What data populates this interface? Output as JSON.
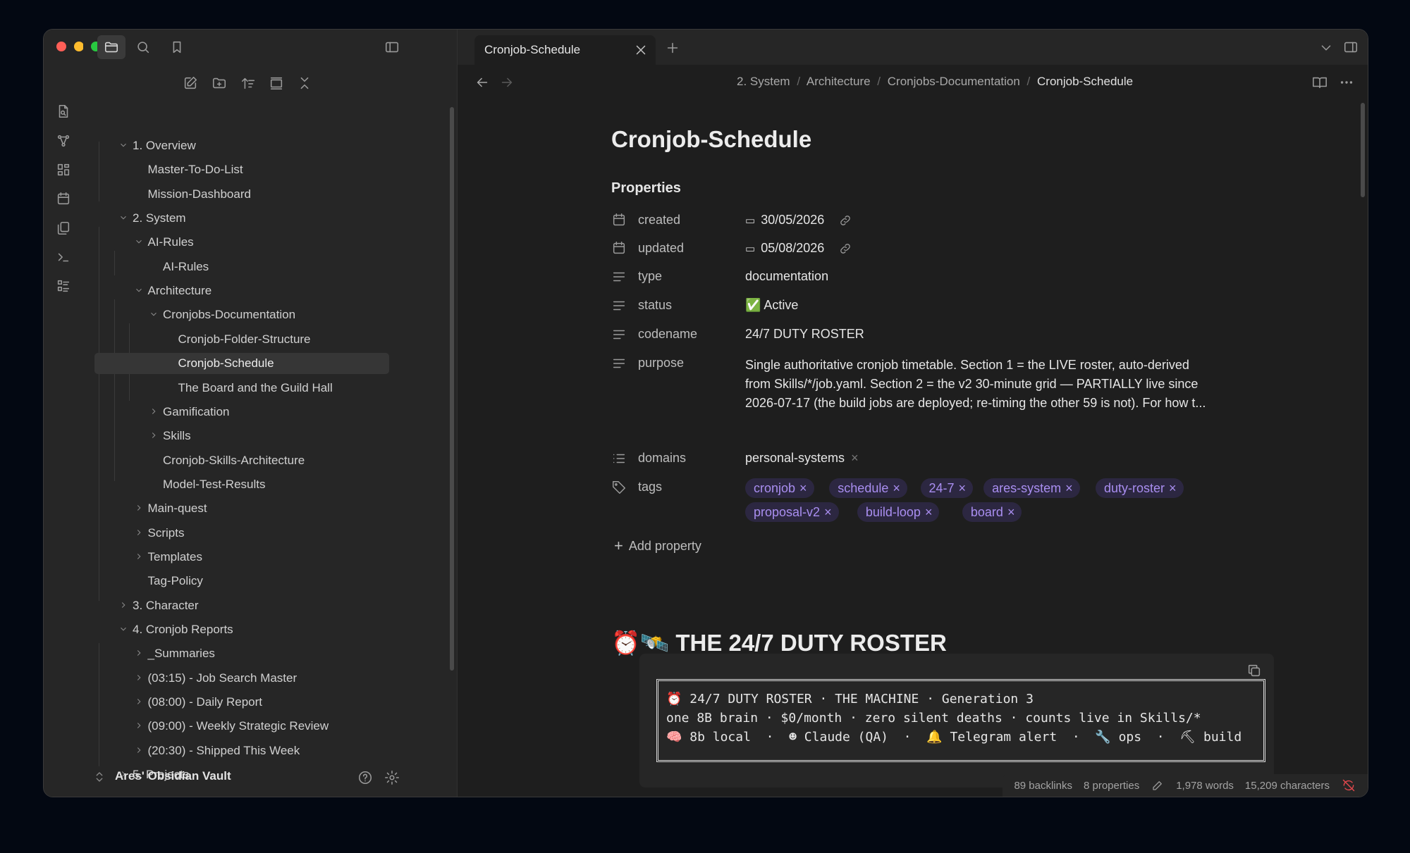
{
  "tab": {
    "title": "Cronjob-Schedule"
  },
  "breadcrumb": [
    "2. System",
    "Architecture",
    "Cronjobs-Documentation",
    "Cronjob-Schedule"
  ],
  "tree": [
    {
      "label": "1. Overview",
      "chevron": "down"
    },
    {
      "label": "Master-To-Do-List"
    },
    {
      "label": "Mission-Dashboard"
    },
    {
      "label": "2. System",
      "chevron": "down"
    },
    {
      "label": "AI-Rules",
      "chevron": "down"
    },
    {
      "label": "AI-Rules"
    },
    {
      "label": "Architecture",
      "chevron": "down"
    },
    {
      "label": "Cronjobs-Documentation",
      "chevron": "down"
    },
    {
      "label": "Cronjob-Folder-Structure"
    },
    {
      "label": "Cronjob-Schedule",
      "active": true
    },
    {
      "label": "The Board and the Guild Hall"
    },
    {
      "label": "Gamification",
      "chevron": "right"
    },
    {
      "label": "Skills",
      "chevron": "right"
    },
    {
      "label": "Cronjob-Skills-Architecture"
    },
    {
      "label": "Model-Test-Results"
    },
    {
      "label": "Main-quest",
      "chevron": "right"
    },
    {
      "label": "Scripts",
      "chevron": "right"
    },
    {
      "label": "Templates",
      "chevron": "right"
    },
    {
      "label": "Tag-Policy"
    },
    {
      "label": "3. Character",
      "chevron": "right"
    },
    {
      "label": "4. Cronjob Reports",
      "chevron": "down"
    },
    {
      "label": "_Summaries",
      "chevron": "right"
    },
    {
      "label": "(03:15) - Job Search Master",
      "chevron": "right"
    },
    {
      "label": "(08:00) - Daily Report",
      "chevron": "right"
    },
    {
      "label": "(09:00) - Weekly Strategic Review",
      "chevron": "right"
    },
    {
      "label": "(20:30) - Shipped This Week",
      "chevron": "right"
    },
    {
      "label": "5. Projects",
      "chevron": "right"
    }
  ],
  "vault": {
    "name": "Ares' Obsidian Vault"
  },
  "note": {
    "title": "Cronjob-Schedule",
    "properties_heading": "Properties",
    "properties": {
      "created": {
        "name": "created",
        "date": "30/05/2026"
      },
      "updated": {
        "name": "updated",
        "date": "05/08/2026"
      },
      "type": {
        "name": "type",
        "value": "documentation"
      },
      "status": {
        "name": "status",
        "value": "✅ Active"
      },
      "codename": {
        "name": "codename",
        "value": "24/7 DUTY ROSTER"
      },
      "purpose": {
        "name": "purpose",
        "lines": [
          "Single authoritative cronjob timetable. Section 1 = the LIVE roster, auto-derived",
          "from Skills/*/job.yaml. Section 2 = the v2 30-minute grid — PARTIALLY live since",
          "2026-07-17 (the build jobs are deployed; re-timing the other 59 is not). For how t..."
        ]
      },
      "domains": {
        "name": "domains",
        "value": "personal-systems"
      },
      "tags": {
        "name": "tags",
        "values": [
          "cronjob",
          "schedule",
          "24-7",
          "ares-system",
          "duty-roster",
          "proposal-v2",
          "build-loop",
          "board"
        ]
      }
    },
    "add_property": "Add property",
    "heading": "⏰🛰️ THE 24/7 DUTY ROSTER",
    "code_lines": [
      "⏰ 24/7 DUTY ROSTER · THE MACHINE · Generation 3",
      "one 8B brain · $0/month · zero silent deaths · counts live in Skills/*",
      "🧠 8b local  ·  ☻ Claude (QA)  ·  🔔 Telegram alert  ·  🔧 ops  ·  ⛏ build"
    ]
  },
  "status_bar": {
    "backlinks": "89 backlinks",
    "properties": "8 properties",
    "words": "1,978 words",
    "characters": "15,209 characters"
  },
  "colors": {
    "accent": "#a98ef0",
    "tag_bg": "#2c2741",
    "close": "#ff5f57",
    "minimize": "#febc2e",
    "zoom": "#28c840",
    "sync_error": "#e5484d"
  }
}
